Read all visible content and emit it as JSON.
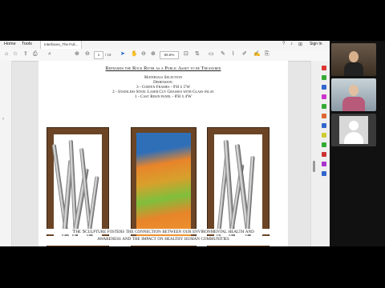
{
  "menubar": {
    "home": "Home",
    "tools": "Tools",
    "doc_tab": "Interfaces_The Full...",
    "sign_in": "Sign In"
  },
  "toolbar": {
    "page_current": "1",
    "page_total": "/ 18",
    "zoom": "65.6%"
  },
  "slide": {
    "heading": "Reframes the Rock River as a Public Asset to be Treasured",
    "materials_title": "Materials Selection",
    "dimension_title": "Dimension:",
    "item1": "3 - Corten Frames - 9'H x 5'W",
    "item2": "2 - Stainless Steel Laser Cut Grasses with Glass inlay",
    "item3": "1 - Cast Resin panel - 8'H x 4'W",
    "footer_line1": "The Sculpture fosters the connection between our environmental health and",
    "footer_line2": "awareness and the impact on healthy human communities"
  },
  "colors": {
    "corten": "#6b4526",
    "resin_blue": "#2f6fb8",
    "resin_orange": "#e8842a",
    "resin_green": "#7fbf3c",
    "accent": "#1a5fd0"
  },
  "icons": [
    "home-icon",
    "star-icon",
    "print-icon",
    "search-icon",
    "up-arrow-icon",
    "down-arrow-icon",
    "cursor-icon",
    "hand-icon",
    "zoom-out-icon",
    "zoom-in-icon",
    "fit-page-icon",
    "comment-icon",
    "pen-icon",
    "highlight-icon",
    "sign-icon",
    "share-icon",
    "more-icon"
  ]
}
